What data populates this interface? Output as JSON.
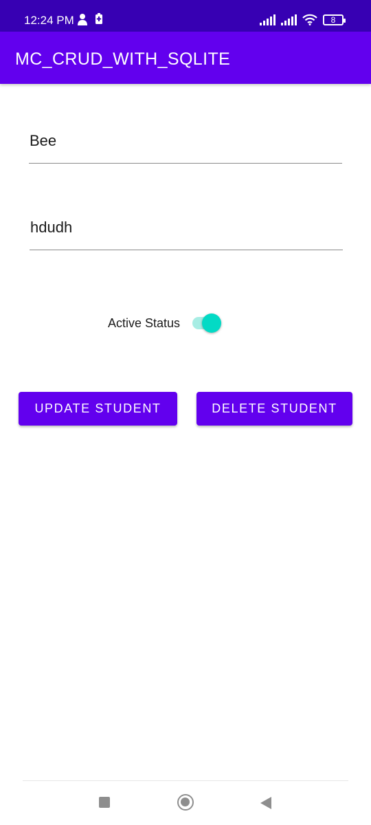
{
  "status_bar": {
    "time": "12:24 PM",
    "battery_level": "8",
    "icons": [
      "user-icon",
      "battery-saver-icon",
      "signal-icon",
      "signal-icon",
      "wifi-icon",
      "battery-icon"
    ]
  },
  "app_bar": {
    "title": "MC_CRUD_WITH_SQLITE"
  },
  "form": {
    "name_value": "Bee",
    "description_value": "hdudh",
    "active_label": "Active Status",
    "active_on": true
  },
  "buttons": {
    "update_label": "UPDATE STUDENT",
    "delete_label": "DELETE STUDENT"
  },
  "nav_bar": {
    "icons": [
      "recents-icon",
      "home-icon",
      "back-icon"
    ]
  },
  "colors": {
    "status_bar": "#3700b3",
    "primary": "#6200ee",
    "switch_thumb": "#03dac5",
    "switch_track": "#a7ede4"
  }
}
